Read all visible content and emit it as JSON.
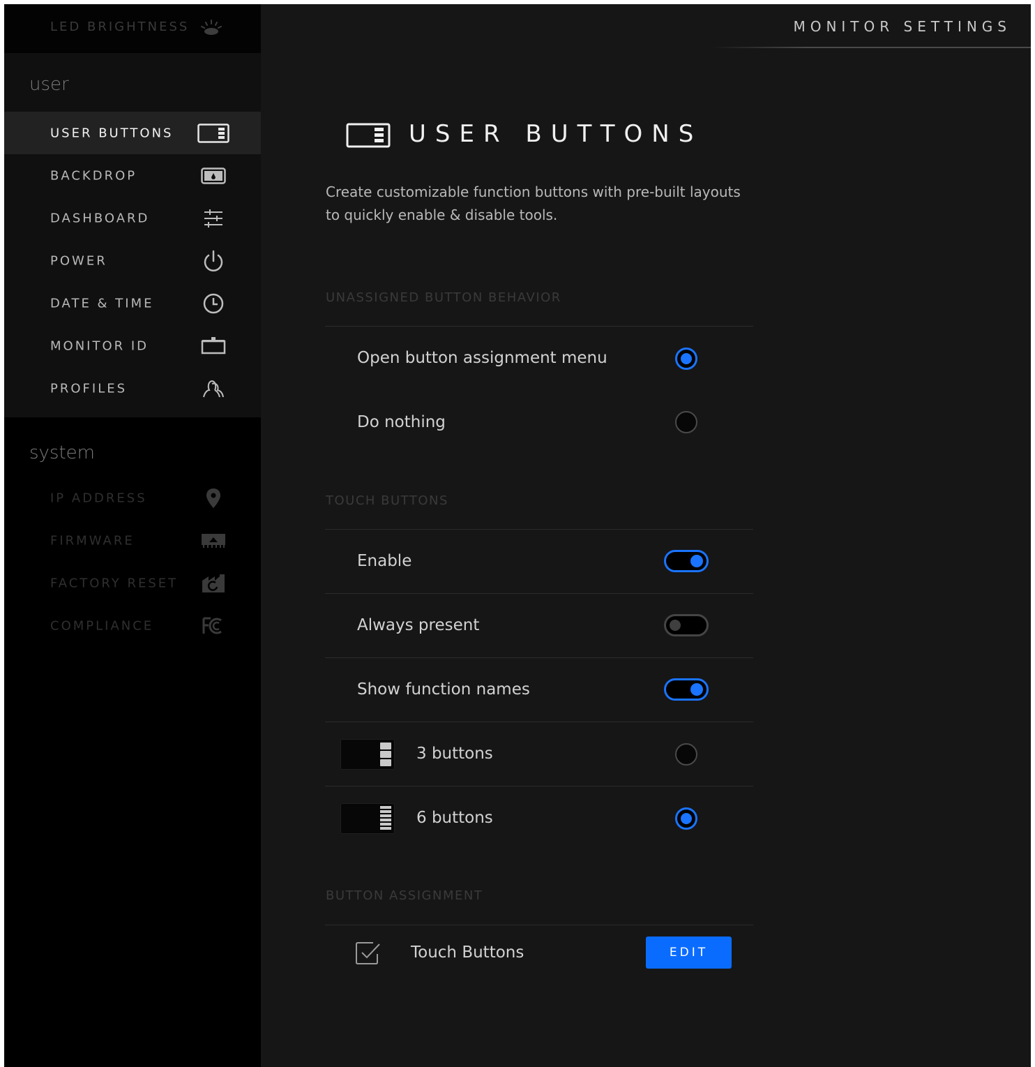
{
  "sidebar": {
    "led_label": "LED BRIGHTNESS",
    "user_group_title": "user",
    "system_group_title": "system",
    "user_items": [
      {
        "label": "USER BUTTONS",
        "icon": "user-buttons-icon",
        "active": true
      },
      {
        "label": "BACKDROP",
        "icon": "backdrop-icon"
      },
      {
        "label": "DASHBOARD",
        "icon": "sliders-icon"
      },
      {
        "label": "POWER",
        "icon": "power-icon"
      },
      {
        "label": "DATE & TIME",
        "icon": "clock-icon"
      },
      {
        "label": "MONITOR ID",
        "icon": "monitor-id-icon"
      },
      {
        "label": "PROFILES",
        "icon": "profiles-icon"
      }
    ],
    "system_items": [
      {
        "label": "IP ADDRESS",
        "icon": "location-pin-icon"
      },
      {
        "label": "FIRMWARE",
        "icon": "firmware-icon"
      },
      {
        "label": "FACTORY RESET",
        "icon": "factory-reset-icon"
      },
      {
        "label": "COMPLIANCE",
        "icon": "fcc-icon"
      }
    ]
  },
  "header": {
    "title": "MONITOR SETTINGS"
  },
  "main": {
    "title": "USER BUTTONS",
    "description": "Create customizable function buttons with pre-built layouts to quickly enable & disable tools.",
    "unassigned": {
      "title": "UNASSIGNED BUTTON BEHAVIOR",
      "options": [
        {
          "label": "Open button assignment menu",
          "selected": true
        },
        {
          "label": "Do nothing",
          "selected": false
        }
      ]
    },
    "touch": {
      "title": "TOUCH BUTTONS",
      "toggles": [
        {
          "label": "Enable",
          "on": true
        },
        {
          "label": "Always present",
          "on": false
        },
        {
          "label": "Show function names",
          "on": true
        }
      ],
      "layouts": [
        {
          "label": "3 buttons",
          "selected": false
        },
        {
          "label": "6 buttons",
          "selected": true
        }
      ]
    },
    "assignment": {
      "title": "BUTTON ASSIGNMENT",
      "label": "Touch Buttons",
      "edit_label": "EDIT"
    }
  },
  "colors": {
    "accent": "#1a74ff",
    "edit_button": "#0a6cff",
    "background": "#161616",
    "sidebar": "#000000"
  }
}
